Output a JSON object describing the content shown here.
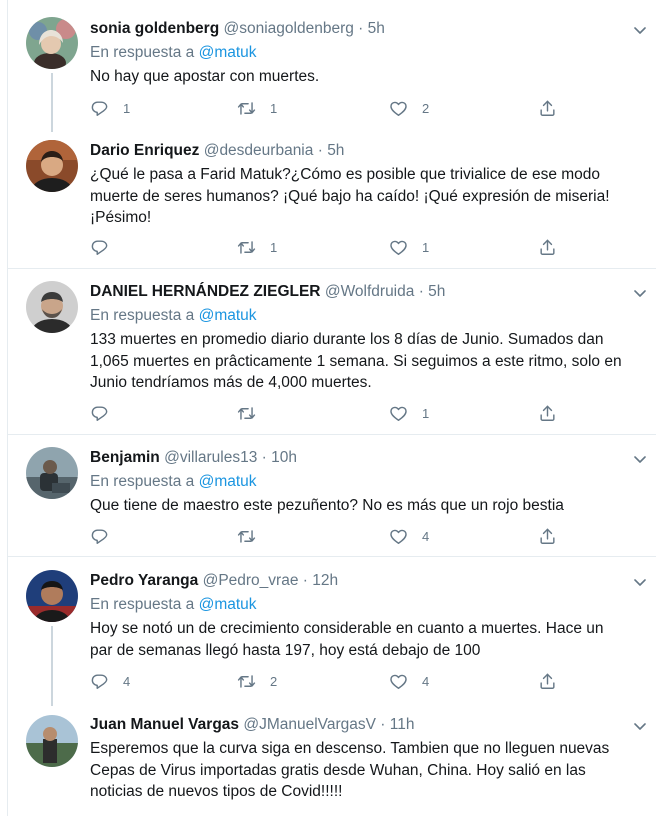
{
  "reply_prefix": "En respuesta a",
  "colors": {
    "accent": "#1b95e0",
    "muted": "#657786",
    "divider": "#e6ecf0"
  },
  "tweets": [
    {
      "name": "sonia goldenberg",
      "handle": "@soniagoldenberg",
      "time": "5h",
      "reply_to": "@matuk",
      "lines": [
        "No hay que apostar con muertes."
      ],
      "replies": "1",
      "retweets": "1",
      "likes": "2"
    },
    {
      "name": "Dario Enriquez",
      "handle": "@desdeurbania",
      "time": "5h",
      "reply_to": "",
      "lines": [
        "¿Qué le pasa a Farid Matuk?¿Cómo es posible que trivialice de ese modo",
        "muerte de seres humanos? ¡Qué bajo ha caído! ¡Qué expresión de miseria!",
        "¡Pésimo!"
      ],
      "replies": "",
      "retweets": "1",
      "likes": "1"
    },
    {
      "name": "DANIEL HERNÁNDEZ ZIEGLER",
      "handle": "@Wolfdruida",
      "time": "5h",
      "reply_to": "@matuk",
      "lines": [
        "133 muertes en promedio diario durante los 8 días de Junio. Sumados dan",
        "1,065 muertes en prâcticamente 1 semana. Si seguimos a este ritmo, solo en",
        "Junio tendríamos más de 4,000 muertes."
      ],
      "replies": "",
      "retweets": "",
      "likes": "1"
    },
    {
      "name": "Benjamin",
      "handle": "@villarules13",
      "time": "10h",
      "reply_to": "@matuk",
      "lines": [
        "Que tiene de maestro este pezuñento? No es más que un rojo bestia"
      ],
      "replies": "",
      "retweets": "",
      "likes": "4"
    },
    {
      "name": "Pedro Yaranga",
      "handle": "@Pedro_vrae",
      "time": "12h",
      "reply_to": "@matuk",
      "lines": [
        "Hoy se notó un de crecimiento considerable en cuanto a muertes. Hace un",
        "par de semanas llegó hasta 197, hoy está debajo de 100"
      ],
      "replies": "4",
      "retweets": "2",
      "likes": "4"
    },
    {
      "name": "Juan Manuel Vargas",
      "handle": "@JManuelVargasV",
      "time": "11h",
      "reply_to": "",
      "lines": [
        "Esperemos que la curva siga en descenso. Tambien que no lleguen nuevas",
        "Cepas de Virus importadas gratis desde Wuhan, China. Hoy salió en las",
        "noticias de nuevos tipos de Covid!!!!!"
      ],
      "replies": "",
      "retweets": "",
      "likes": ""
    }
  ]
}
